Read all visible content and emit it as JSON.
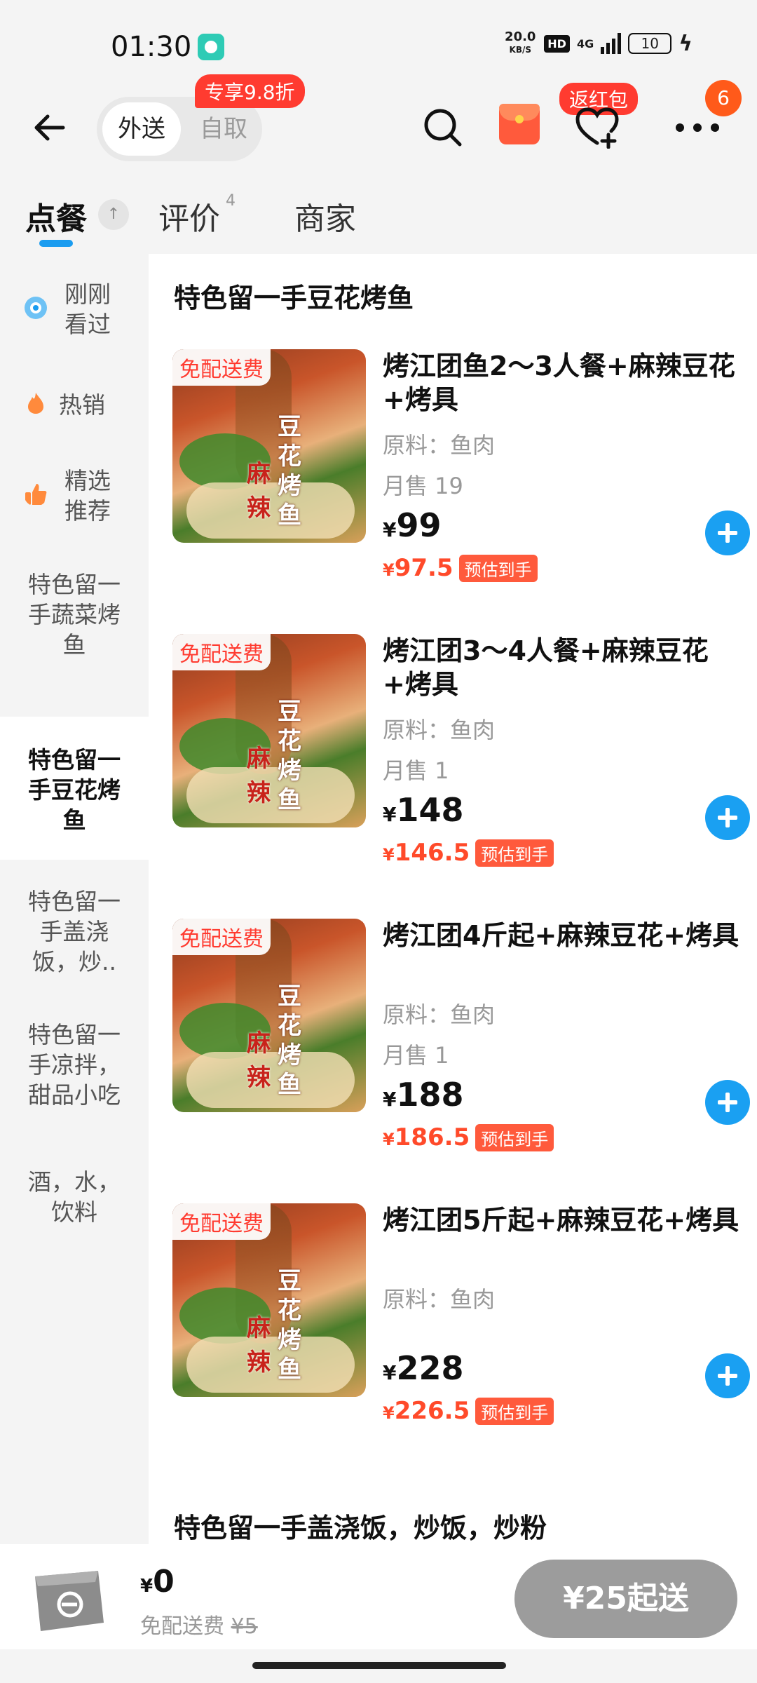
{
  "status_bar": {
    "time": "01:30",
    "net_speed": "20.0",
    "net_unit": "KB/S",
    "hd": "HD",
    "network": "4G",
    "battery": "10"
  },
  "header": {
    "mode_delivery": "外送",
    "mode_pickup": "自取",
    "promo": "专享9.8折",
    "return_badge": "返红包",
    "more_badge": "6",
    "icons": [
      "back-arrow-icon",
      "search-icon",
      "red-packet-icon",
      "heart-plus-icon",
      "more-icon"
    ]
  },
  "tabs": {
    "order": "点餐",
    "pin": "↑",
    "reviews": "评价",
    "reviews_count": "4",
    "merchant": "商家"
  },
  "sidebar": {
    "items": [
      {
        "label": "刚刚看过",
        "line1": "刚刚",
        "line2": "看过",
        "icon": "eye-icon"
      },
      {
        "label": "热销",
        "icon": "flame-icon"
      },
      {
        "label": "精选推荐",
        "line1": "精选",
        "line2": "推荐",
        "icon": "thumbs-up-icon"
      },
      {
        "label": "特色留一手蔬菜烤鱼",
        "line1": "特色留一",
        "line2": "手蔬菜烤",
        "line3": "鱼"
      },
      {
        "label": "特色留一手豆花烤鱼",
        "line1": "特色留一",
        "line2": "手豆花烤",
        "line3": "鱼",
        "active": true
      },
      {
        "label": "特色留一手盖浇饭，炒..",
        "line1": "特色留一",
        "line2": "手盖浇",
        "line3": "饭，炒.."
      },
      {
        "label": "特色留一手凉拌，甜品小吃",
        "line1": "特色留一",
        "line2": "手凉拌，",
        "line3": "甜品小吃"
      },
      {
        "label": "酒，水，饮料",
        "line1": "酒，水，",
        "line2": "饮料"
      }
    ]
  },
  "main": {
    "section_title": "特色留一手豆花烤鱼",
    "next_section_title": "特色留一手盖浇饭，炒饭，炒粉",
    "free_delivery_tag": "免配送费",
    "image_text_1": "豆花烤鱼",
    "image_text_2": "麻辣",
    "est_label": "预估到手",
    "currency": "¥",
    "items": [
      {
        "title": "烤江团鱼2～3人餐+麻辣豆花+烤具",
        "ingredients": "原料：鱼肉",
        "sales": "月售 19",
        "price": "99",
        "est": "97.5"
      },
      {
        "title": "烤江团3～4人餐+麻辣豆花+烤具",
        "ingredients": "原料：鱼肉",
        "sales": "月售 1",
        "price": "148",
        "est": "146.5"
      },
      {
        "title": "烤江团4斤起+麻辣豆花+烤具",
        "ingredients": "原料：鱼肉",
        "sales": "月售 1",
        "price": "188",
        "est": "186.5"
      },
      {
        "title": "烤江团5斤起+麻辣豆花+烤具",
        "ingredients": "原料：鱼肉",
        "sales": "",
        "price": "228",
        "est": "226.5"
      }
    ]
  },
  "cart": {
    "currency": "¥",
    "total": "0",
    "fee_label": "免配送费",
    "fee_original": "¥5",
    "checkout_label": "¥25起送"
  },
  "colors": {
    "accent_blue": "#1aa0f2",
    "price_red": "#ff4a2a",
    "badge_red": "#ff3b30",
    "checkout_gray": "#9c9c9c"
  }
}
